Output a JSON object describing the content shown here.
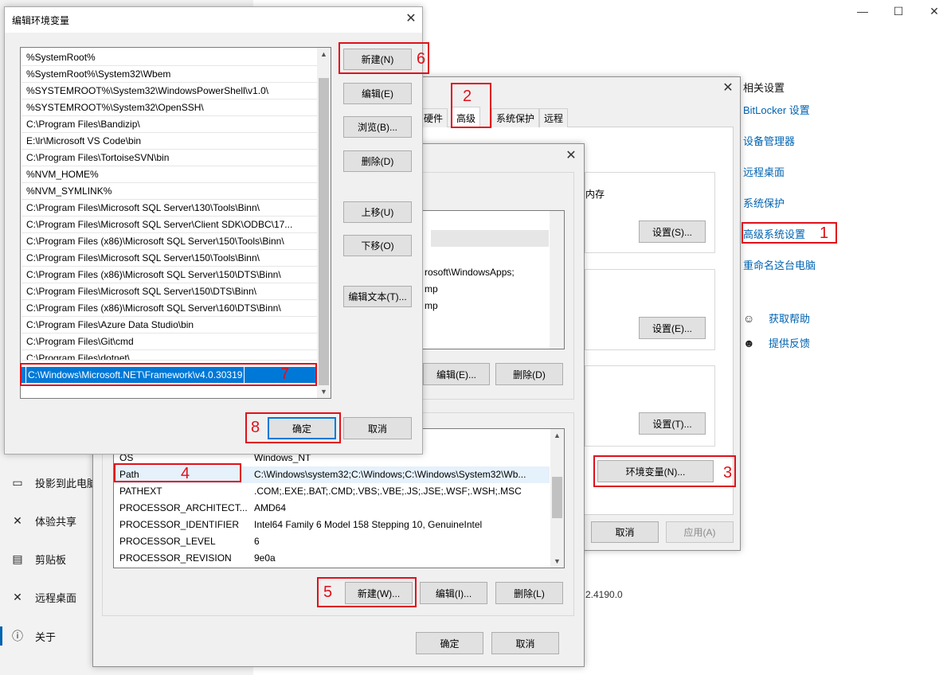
{
  "settings": {
    "window_controls": {
      "minimize": "—",
      "maximize": "☐",
      "close": "✕"
    },
    "nav_items": [
      {
        "label": "投影到此电脑",
        "icon": "projector-icon",
        "glyph": "▭"
      },
      {
        "label": "体验共享",
        "icon": "share-icon",
        "glyph": "✕"
      },
      {
        "label": "剪贴板",
        "icon": "clipboard-icon",
        "glyph": "▤"
      },
      {
        "label": "远程桌面",
        "icon": "remote-desktop-icon",
        "glyph": "✕"
      },
      {
        "label": "关于",
        "icon": "info-icon",
        "glyph": "ⓘ"
      }
    ],
    "related_title": "相关设置",
    "related_links": [
      "BitLocker 设置",
      "设备管理器",
      "远程桌面",
      "系统保护",
      "高级系统设置",
      "重命名这台电脑"
    ],
    "help_items": [
      {
        "label": "获取帮助",
        "icon": "help-chat-icon",
        "glyph": "☺"
      },
      {
        "label": "提供反馈",
        "icon": "feedback-icon",
        "glyph": "☻"
      }
    ],
    "version_fragment": "2.4190.0"
  },
  "system_properties": {
    "tabs": [
      "硬件",
      "高级",
      "系统保护",
      "远程"
    ],
    "fragment_memory": "内存",
    "settings_button": "设置(S)...",
    "settings_e_button": "设置(E)...",
    "settings_t_button": "设置(T)...",
    "env_button": "环境变量(N)...",
    "cancel_label": "取消",
    "apply_label": "应用(A)"
  },
  "env_vars_dialog": {
    "user_fragments": [
      "rosoft\\WindowsApps;",
      "mp",
      "mp"
    ],
    "user_edit_label": "编辑(E)...",
    "user_delete_label": "删除(D)",
    "system_rows": [
      {
        "name": "OS",
        "value": "Windows_NT"
      },
      {
        "name": "Path",
        "value": "C:\\Windows\\system32;C:\\Windows;C:\\Windows\\System32\\Wb..."
      },
      {
        "name": "PATHEXT",
        "value": ".COM;.EXE;.BAT;.CMD;.VBS;.VBE;.JS;.JSE;.WSF;.WSH;.MSC"
      },
      {
        "name": "PROCESSOR_ARCHITECT...",
        "value": "AMD64"
      },
      {
        "name": "PROCESSOR_IDENTIFIER",
        "value": "Intel64 Family 6 Model 158 Stepping 10, GenuineIntel"
      },
      {
        "name": "PROCESSOR_LEVEL",
        "value": "6"
      },
      {
        "name": "PROCESSOR_REVISION",
        "value": "9e0a"
      }
    ],
    "new_label": "新建(W)...",
    "edit_label": "编辑(I)...",
    "delete_label": "删除(L)",
    "ok_label": "确定",
    "cancel_label": "取消"
  },
  "edit_dialog": {
    "title": "编辑环境变量",
    "close": "✕",
    "entries": [
      "%SystemRoot%",
      "%SystemRoot%\\System32\\Wbem",
      "%SYSTEMROOT%\\System32\\WindowsPowerShell\\v1.0\\",
      "%SYSTEMROOT%\\System32\\OpenSSH\\",
      "C:\\Program Files\\Bandizip\\",
      "E:\\lr\\Microsoft VS Code\\bin",
      "C:\\Program Files\\TortoiseSVN\\bin",
      "%NVM_HOME%",
      "%NVM_SYMLINK%",
      "C:\\Program Files\\Microsoft SQL Server\\130\\Tools\\Binn\\",
      "C:\\Program Files\\Microsoft SQL Server\\Client SDK\\ODBC\\17...",
      "C:\\Program Files (x86)\\Microsoft SQL Server\\150\\Tools\\Binn\\",
      "C:\\Program Files\\Microsoft SQL Server\\150\\Tools\\Binn\\",
      "C:\\Program Files (x86)\\Microsoft SQL Server\\150\\DTS\\Binn\\",
      "C:\\Program Files\\Microsoft SQL Server\\150\\DTS\\Binn\\",
      "C:\\Program Files (x86)\\Microsoft SQL Server\\160\\DTS\\Binn\\",
      "C:\\Program Files\\Azure Data Studio\\bin",
      "C:\\Program Files\\Git\\cmd",
      "C:\\Program Files\\dotnet\\"
    ],
    "editing_value": "C:\\Windows\\Microsoft.NET\\Framework\\v4.0.30319",
    "buttons": {
      "new": "新建(N)",
      "edit": "编辑(E)",
      "browse": "浏览(B)...",
      "delete": "删除(D)",
      "move_up": "上移(U)",
      "move_down": "下移(O)",
      "edit_text": "编辑文本(T)...",
      "ok": "确定",
      "cancel": "取消"
    }
  },
  "annotations": {
    "color": "#e0101a",
    "steps": [
      "1",
      "2",
      "3",
      "4",
      "5",
      "6",
      "7",
      "8"
    ]
  },
  "colors": {
    "accent": "#0078d7",
    "link": "#0063b1",
    "annotation": "#e0101a"
  }
}
